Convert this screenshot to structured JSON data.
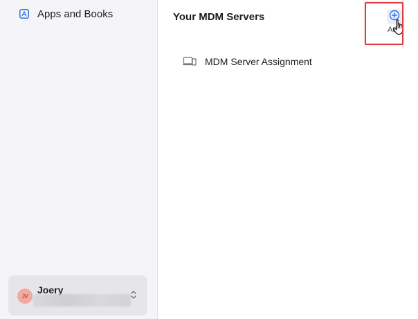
{
  "sidebar": {
    "items": [
      {
        "label": "Apps and Books",
        "icon": "app-store-icon"
      }
    ],
    "account": {
      "name": "Joery",
      "initials": "JV",
      "avatar_color": "#f2a9a1"
    }
  },
  "main": {
    "title": "Your MDM Servers",
    "add_button": {
      "label": "Add",
      "icon": "plus-circle-icon",
      "accent": "#2f6fe4",
      "highlight": "#e0393e"
    },
    "servers": [
      {
        "label": "MDM Server Assignment",
        "icon": "devices-icon"
      }
    ]
  }
}
